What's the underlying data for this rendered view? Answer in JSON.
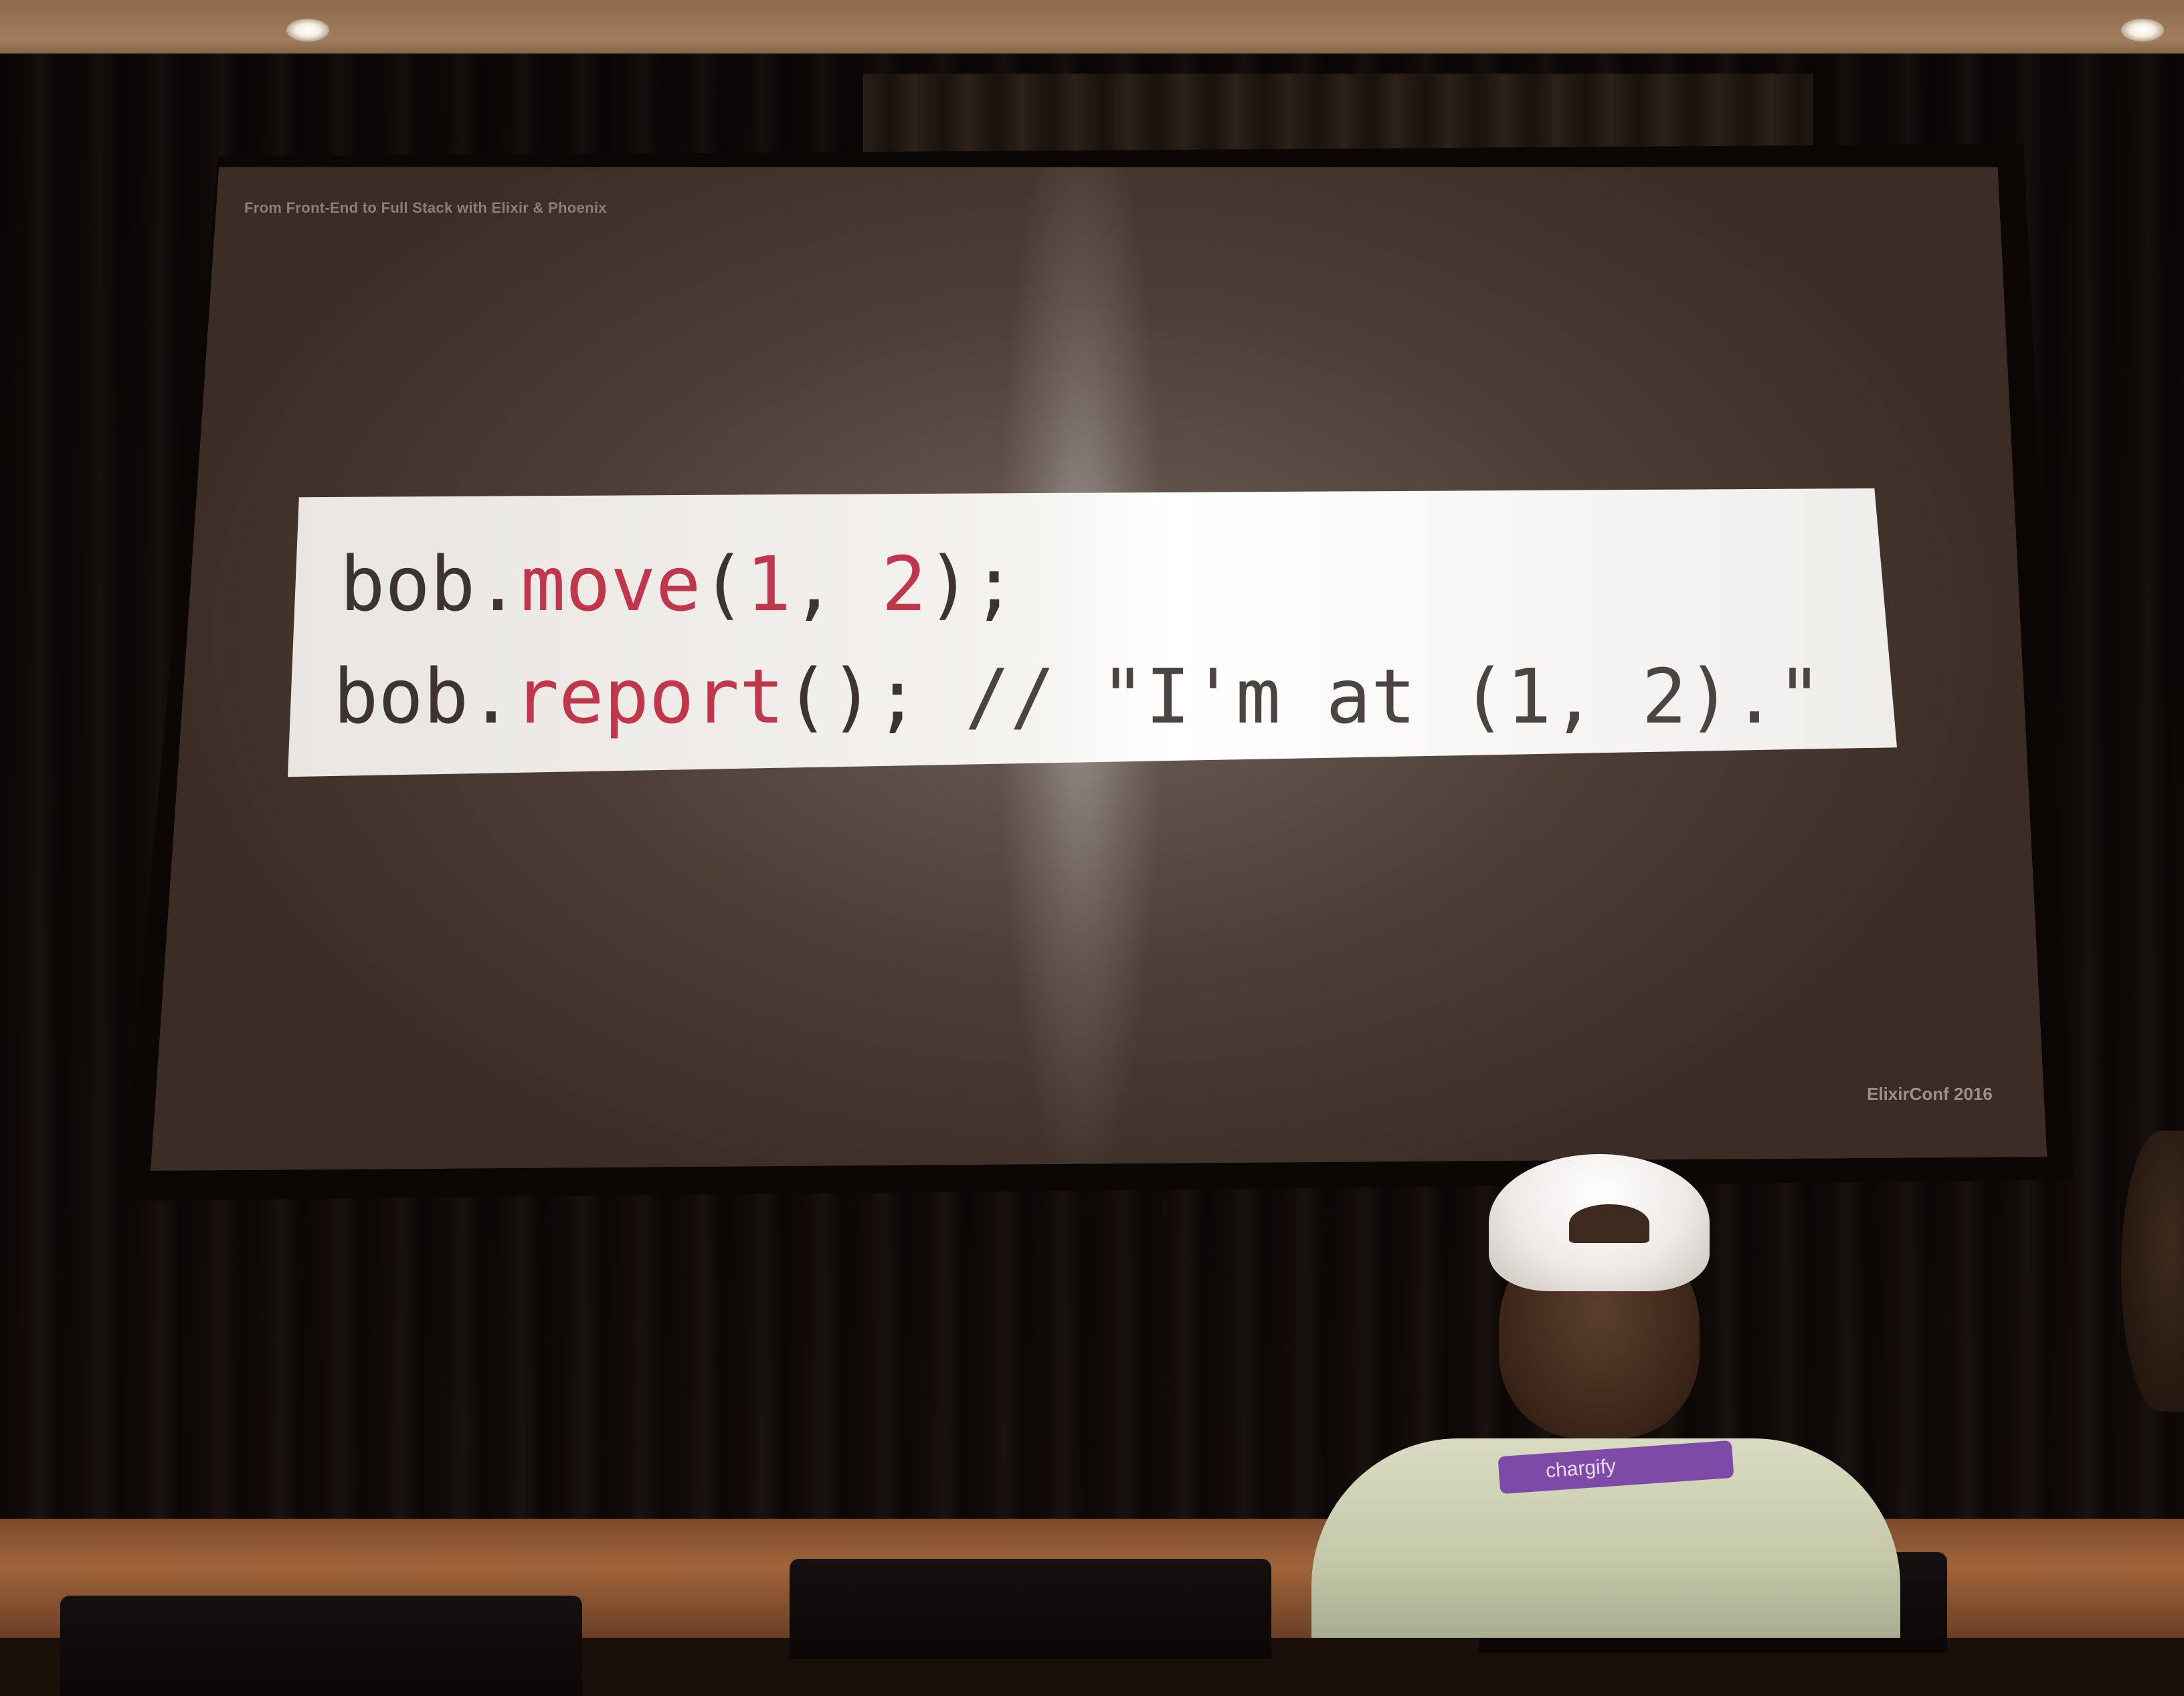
{
  "slide": {
    "header": "From Front-End to Full Stack with Elixir & Phoenix",
    "footer": "ElixirConf 2016",
    "code": {
      "line1": {
        "obj": "bob",
        "dot": ".",
        "method": "move",
        "open": "(",
        "arg1": "1",
        "comma": ", ",
        "arg2": "2",
        "close": ");"
      },
      "line2": {
        "obj": "bob",
        "dot": ".",
        "method": "report",
        "call": "();",
        "comment": " // \"I'm at (1, 2).\""
      }
    }
  },
  "audience": {
    "lanyard_text": "chargify"
  },
  "colors": {
    "code_keyword": "#c0364b",
    "code_plain": "#3d3430",
    "lanyard": "#7d4aa8"
  }
}
